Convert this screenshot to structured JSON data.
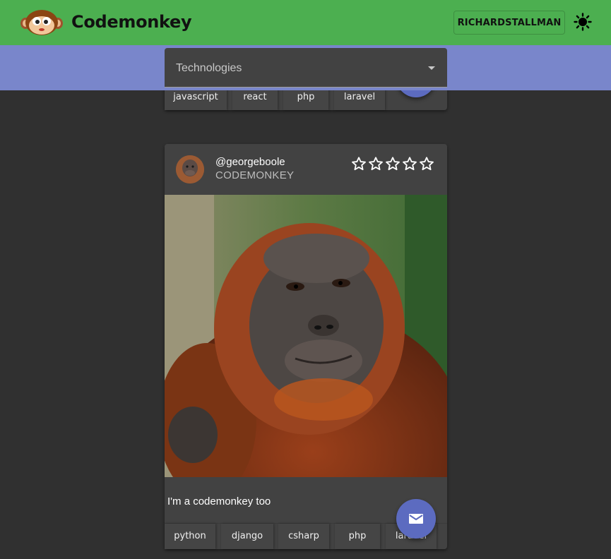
{
  "app": {
    "brand": "Codemonkey",
    "user_button": "RICHARDSTALLMAN",
    "logo_icon": "monkey-logo-icon",
    "theme_icon": "sun-icon"
  },
  "filter": {
    "label": "Technologies",
    "caret_icon": "dropdown-caret-icon"
  },
  "posts": [
    {
      "tags": [
        "javascript",
        "react",
        "php",
        "laravel"
      ]
    },
    {
      "handle": "@georgeboole",
      "subheader": "CODEMONKEY",
      "rating": 0,
      "max_rating": 5,
      "star_icon": "star-outline-icon",
      "image": "orangutan-photo",
      "caption": "I'm a codemonkey too",
      "tags": [
        "python",
        "django",
        "csharp",
        "php",
        "laravel"
      ],
      "action_icon": "mail-icon"
    }
  ],
  "colors": {
    "appbar": "#4caf50",
    "filterbar": "#7986cb",
    "background": "#303030",
    "card": "#424242",
    "fab": "#5c6bc0"
  }
}
